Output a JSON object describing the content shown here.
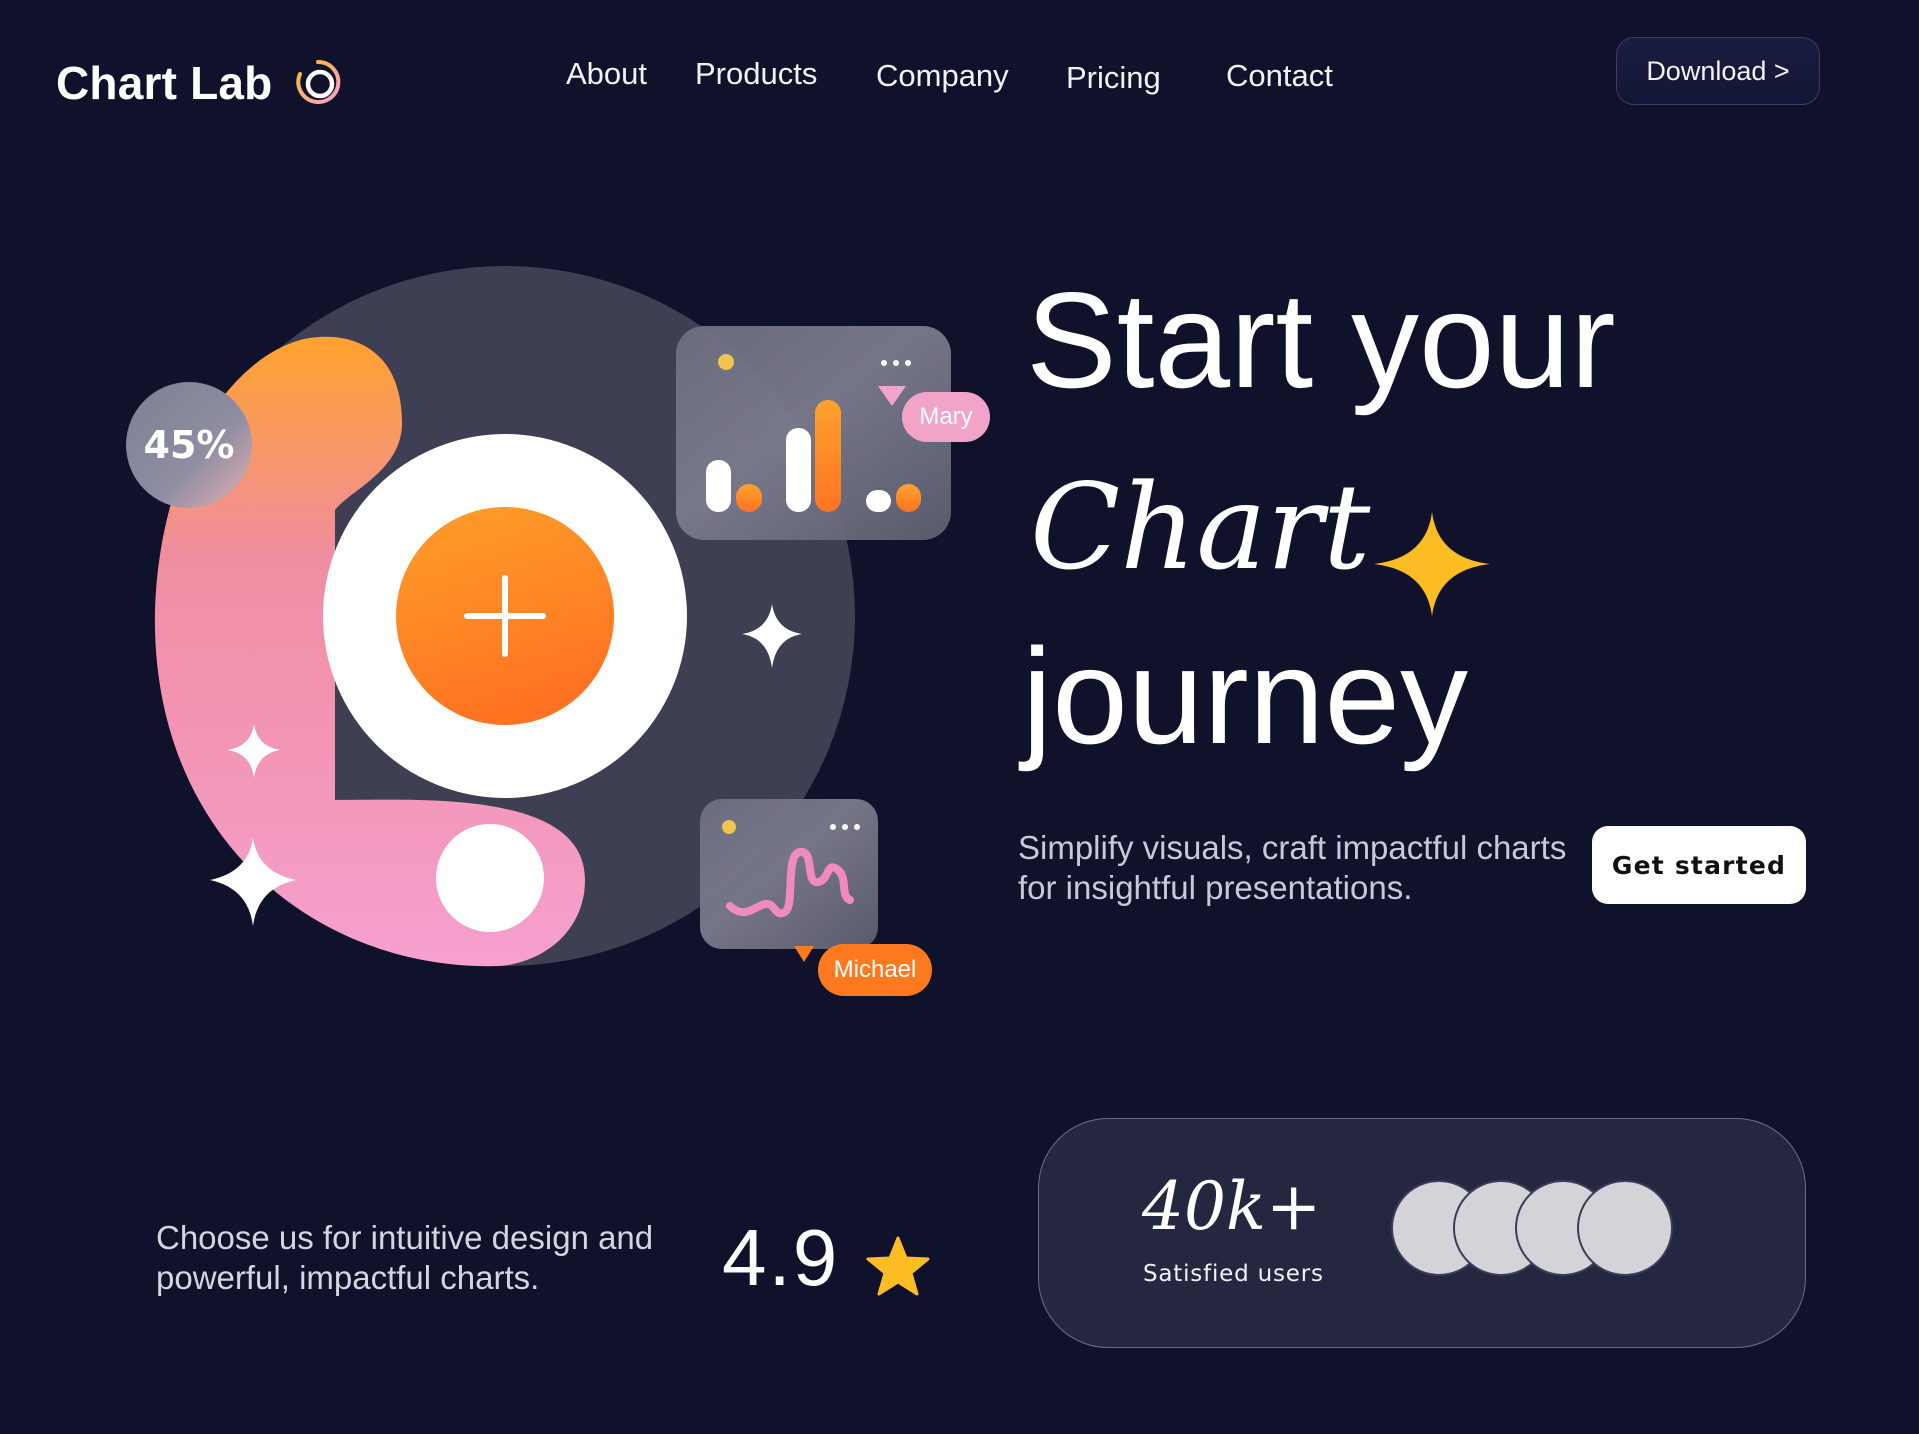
{
  "brand": {
    "name": "Chart Lab"
  },
  "nav": {
    "items": [
      {
        "label": "About"
      },
      {
        "label": "Products"
      },
      {
        "label": "Company"
      },
      {
        "label": "Pricing"
      },
      {
        "label": "Contact"
      }
    ],
    "download_label": "Download >"
  },
  "hero": {
    "line1": "Start your",
    "line2": "Chart",
    "line3": "journey",
    "subtext": "Simplify visuals, craft impactful charts for insightful presentations.",
    "cta_label": "Get started"
  },
  "illustration": {
    "percent_badge": "45%",
    "card_top_user": "Mary",
    "card_bottom_user": "Michael"
  },
  "stats": {
    "choose_text": "Choose us for intuitive design and  powerful, impactful charts.",
    "rating": "4.9",
    "users_count": "40k+",
    "users_label": "Satisfied users",
    "avatar_count": 4
  },
  "colors": {
    "background": "#10112b",
    "orange": "#ff7a1f",
    "pink": "#f6a0cf",
    "yellow": "#fbbd23",
    "card": "#252741"
  },
  "icons": [
    "logo-ring-icon",
    "plus-icon",
    "sparkle-icon",
    "star-icon",
    "more-dots-icon"
  ]
}
